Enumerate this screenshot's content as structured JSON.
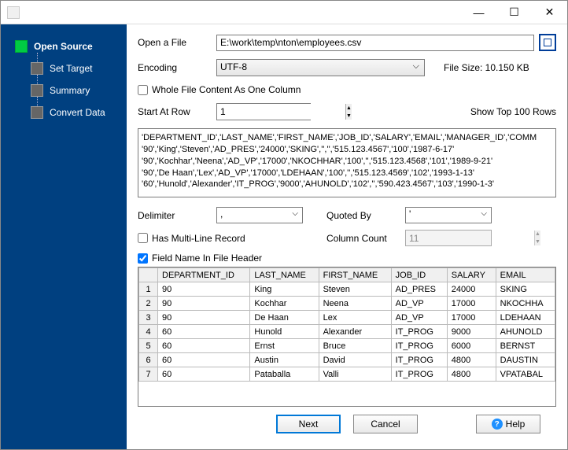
{
  "sidebar": {
    "items": [
      {
        "label": "Open Source",
        "active": true
      },
      {
        "label": "Set Target",
        "active": false
      },
      {
        "label": "Summary",
        "active": false
      },
      {
        "label": "Convert Data",
        "active": false
      }
    ]
  },
  "form": {
    "open_file_label": "Open a File",
    "open_file_value": "E:\\work\\temp\\nton\\employees.csv",
    "encoding_label": "Encoding",
    "encoding_value": "UTF-8",
    "file_size_label": "File Size: 10.150 KB",
    "whole_file_label": "Whole File Content As One Column",
    "start_row_label": "Start At Row",
    "start_row_value": "1",
    "show_top_label": "Show Top 100 Rows",
    "delimiter_label": "Delimiter",
    "delimiter_value": ",",
    "quoted_by_label": "Quoted By",
    "quoted_by_value": "'",
    "multiline_label": "Has Multi-Line Record",
    "column_count_label": "Column Count",
    "column_count_value": "11",
    "field_header_label": "Field Name In File Header"
  },
  "preview_lines": [
    "'DEPARTMENT_ID','LAST_NAME','FIRST_NAME','JOB_ID','SALARY','EMAIL','MANAGER_ID','COMM",
    "'90','King','Steven','AD_PRES','24000','SKING','','','515.123.4567','100','1987-6-17'",
    "'90','Kochhar','Neena','AD_VP','17000','NKOCHHAR','100','','515.123.4568','101','1989-9-21'",
    "'90','De Haan','Lex','AD_VP','17000','LDEHAAN','100','','515.123.4569','102','1993-1-13'",
    "'60','Hunold','Alexander','IT_PROG','9000','AHUNOLD','102','','590.423.4567','103','1990-1-3'"
  ],
  "table": {
    "headers": [
      "DEPARTMENT_ID",
      "LAST_NAME",
      "FIRST_NAME",
      "JOB_ID",
      "SALARY",
      "EMAIL"
    ],
    "rows": [
      [
        "90",
        "King",
        "Steven",
        "AD_PRES",
        "24000",
        "SKING"
      ],
      [
        "90",
        "Kochhar",
        "Neena",
        "AD_VP",
        "17000",
        "NKOCHHA"
      ],
      [
        "90",
        "De Haan",
        "Lex",
        "AD_VP",
        "17000",
        "LDEHAAN"
      ],
      [
        "60",
        "Hunold",
        "Alexander",
        "IT_PROG",
        "9000",
        "AHUNOLD"
      ],
      [
        "60",
        "Ernst",
        "Bruce",
        "IT_PROG",
        "6000",
        "BERNST"
      ],
      [
        "60",
        "Austin",
        "David",
        "IT_PROG",
        "4800",
        "DAUSTIN"
      ],
      [
        "60",
        "Pataballa",
        "Valli",
        "IT_PROG",
        "4800",
        "VPATABAL"
      ]
    ]
  },
  "buttons": {
    "next": "Next",
    "cancel": "Cancel",
    "help": "Help"
  }
}
